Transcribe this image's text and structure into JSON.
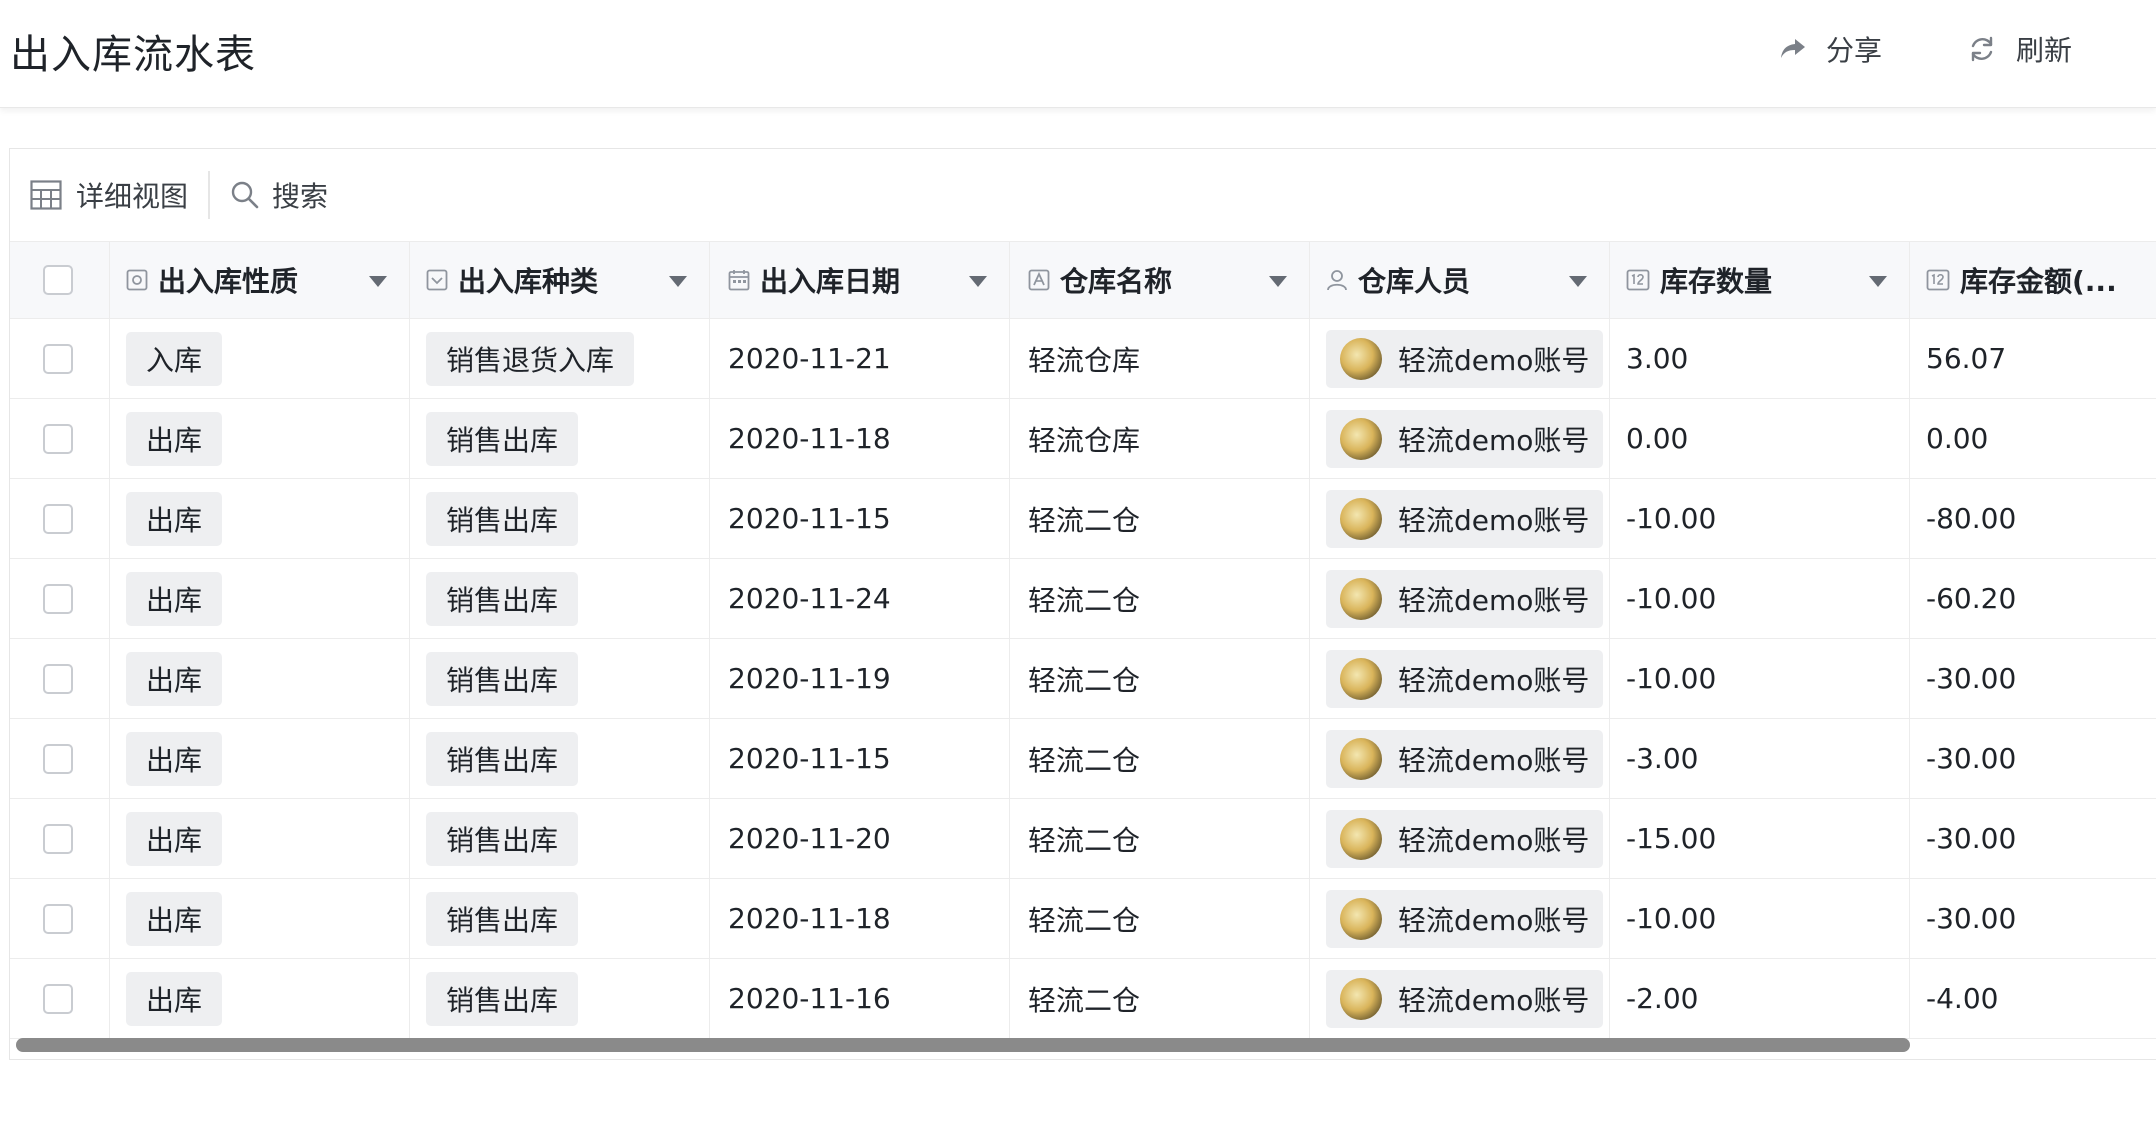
{
  "header": {
    "title": "出入库流水表",
    "share_label": "分享",
    "refresh_label": "刷新"
  },
  "toolbar": {
    "view_label": "详细视图",
    "search_label": "搜索"
  },
  "table": {
    "columns": [
      {
        "label": "出入库性质",
        "icon": "radio-field-icon"
      },
      {
        "label": "出入库种类",
        "icon": "select-field-icon"
      },
      {
        "label": "出入库日期",
        "icon": "calendar-icon"
      },
      {
        "label": "仓库名称",
        "icon": "text-field-icon"
      },
      {
        "label": "仓库人员",
        "icon": "person-icon"
      },
      {
        "label": "库存数量",
        "icon": "number-field-icon"
      },
      {
        "label": "库存金额(...",
        "icon": "number-field-icon"
      }
    ],
    "rows": [
      {
        "nature": "入库",
        "kind": "销售退货入库",
        "date": "2020-11-21",
        "warehouse": "轻流仓库",
        "person": "轻流demo账号",
        "qty": "3.00",
        "amount": "56.07"
      },
      {
        "nature": "出库",
        "kind": "销售出库",
        "date": "2020-11-18",
        "warehouse": "轻流仓库",
        "person": "轻流demo账号",
        "qty": "0.00",
        "amount": "0.00"
      },
      {
        "nature": "出库",
        "kind": "销售出库",
        "date": "2020-11-15",
        "warehouse": "轻流二仓",
        "person": "轻流demo账号",
        "qty": "-10.00",
        "amount": "-80.00"
      },
      {
        "nature": "出库",
        "kind": "销售出库",
        "date": "2020-11-24",
        "warehouse": "轻流二仓",
        "person": "轻流demo账号",
        "qty": "-10.00",
        "amount": "-60.20"
      },
      {
        "nature": "出库",
        "kind": "销售出库",
        "date": "2020-11-19",
        "warehouse": "轻流二仓",
        "person": "轻流demo账号",
        "qty": "-10.00",
        "amount": "-30.00"
      },
      {
        "nature": "出库",
        "kind": "销售出库",
        "date": "2020-11-15",
        "warehouse": "轻流二仓",
        "person": "轻流demo账号",
        "qty": "-3.00",
        "amount": "-30.00"
      },
      {
        "nature": "出库",
        "kind": "销售出库",
        "date": "2020-11-20",
        "warehouse": "轻流二仓",
        "person": "轻流demo账号",
        "qty": "-15.00",
        "amount": "-30.00"
      },
      {
        "nature": "出库",
        "kind": "销售出库",
        "date": "2020-11-18",
        "warehouse": "轻流二仓",
        "person": "轻流demo账号",
        "qty": "-10.00",
        "amount": "-30.00"
      },
      {
        "nature": "出库",
        "kind": "销售出库",
        "date": "2020-11-16",
        "warehouse": "轻流二仓",
        "person": "轻流demo账号",
        "qty": "-2.00",
        "amount": "-4.00"
      }
    ]
  }
}
